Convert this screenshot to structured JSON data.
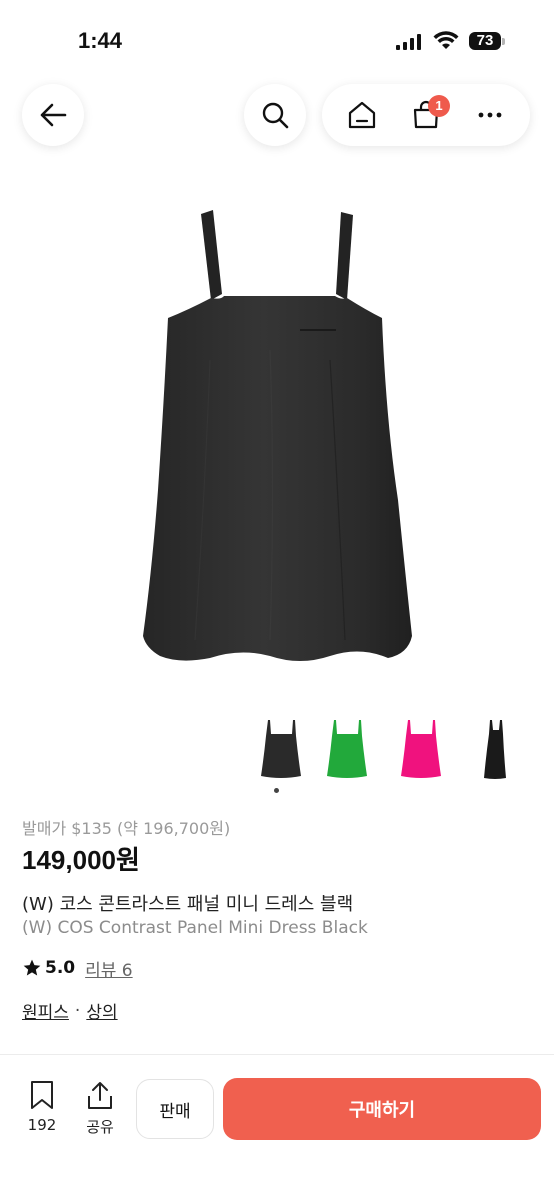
{
  "status": {
    "time": "1:44",
    "battery": "73"
  },
  "nav": {
    "cart_count": "1"
  },
  "colors": {
    "accent": "#f0604f",
    "badge": "#ef5a4c"
  },
  "thumbnails": [
    {
      "color_name": "black"
    },
    {
      "color_name": "green"
    },
    {
      "color_name": "pink"
    },
    {
      "color_name": "black-long"
    }
  ],
  "product": {
    "retail": "발매가 $135 (약 196,700원)",
    "price": "149,000원",
    "title_ko": "(W) 코스 콘트라스트 패널 미니 드레스 블랙",
    "title_en": "(W) COS Contrast Panel Mini Dress Black",
    "rating": "5.0",
    "reviews": "리뷰 6",
    "category_1": "원피스",
    "category_sep": "·",
    "category_2": "상의"
  },
  "bottom": {
    "bookmark_count": "192",
    "share_label": "공유",
    "sell_label": "판매",
    "buy_label": "구매하기"
  }
}
